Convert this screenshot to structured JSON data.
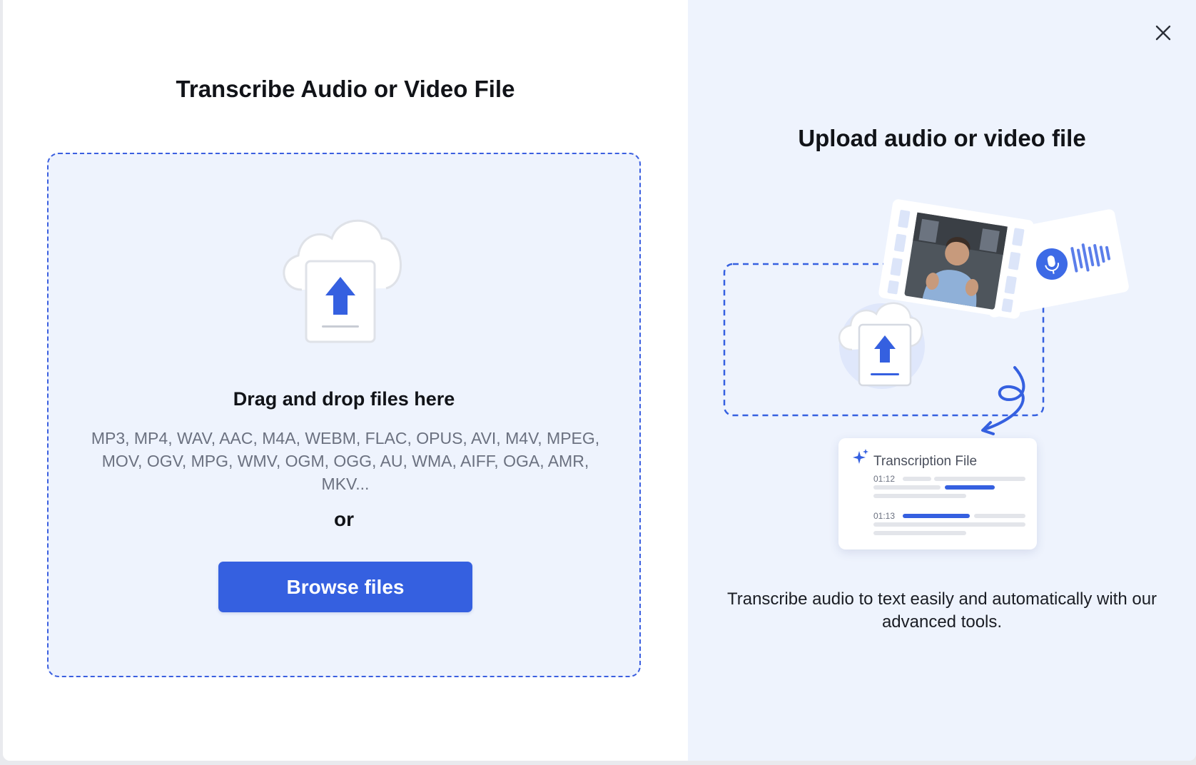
{
  "left": {
    "title": "Transcribe Audio or Video File",
    "dropzone": {
      "drag_title": "Drag and drop files here",
      "formats": "MP3, MP4, WAV, AAC, M4A, WEBM, FLAC, OPUS, AVI, M4V, MPEG, MOV, OGV, MPG, WMV, OGM, OGG, AU, WMA, AIFF, OGA, AMR, MKV...",
      "or": "or",
      "browse_label": "Browse files"
    }
  },
  "right": {
    "title": "Upload audio or video file",
    "description": "Transcribe audio to text easily and automatically with our advanced tools.",
    "illustration": {
      "card_title": "Transcription File",
      "timestamps": [
        "01:12",
        "01:13"
      ]
    }
  },
  "icons": {
    "close": "close-icon",
    "upload": "cloud-upload-icon",
    "microphone": "microphone-icon",
    "sparkle": "sparkle-icon"
  },
  "colors": {
    "accent": "#3560e0",
    "panel_bg": "#eef3fd",
    "text_muted": "#6b7180"
  }
}
